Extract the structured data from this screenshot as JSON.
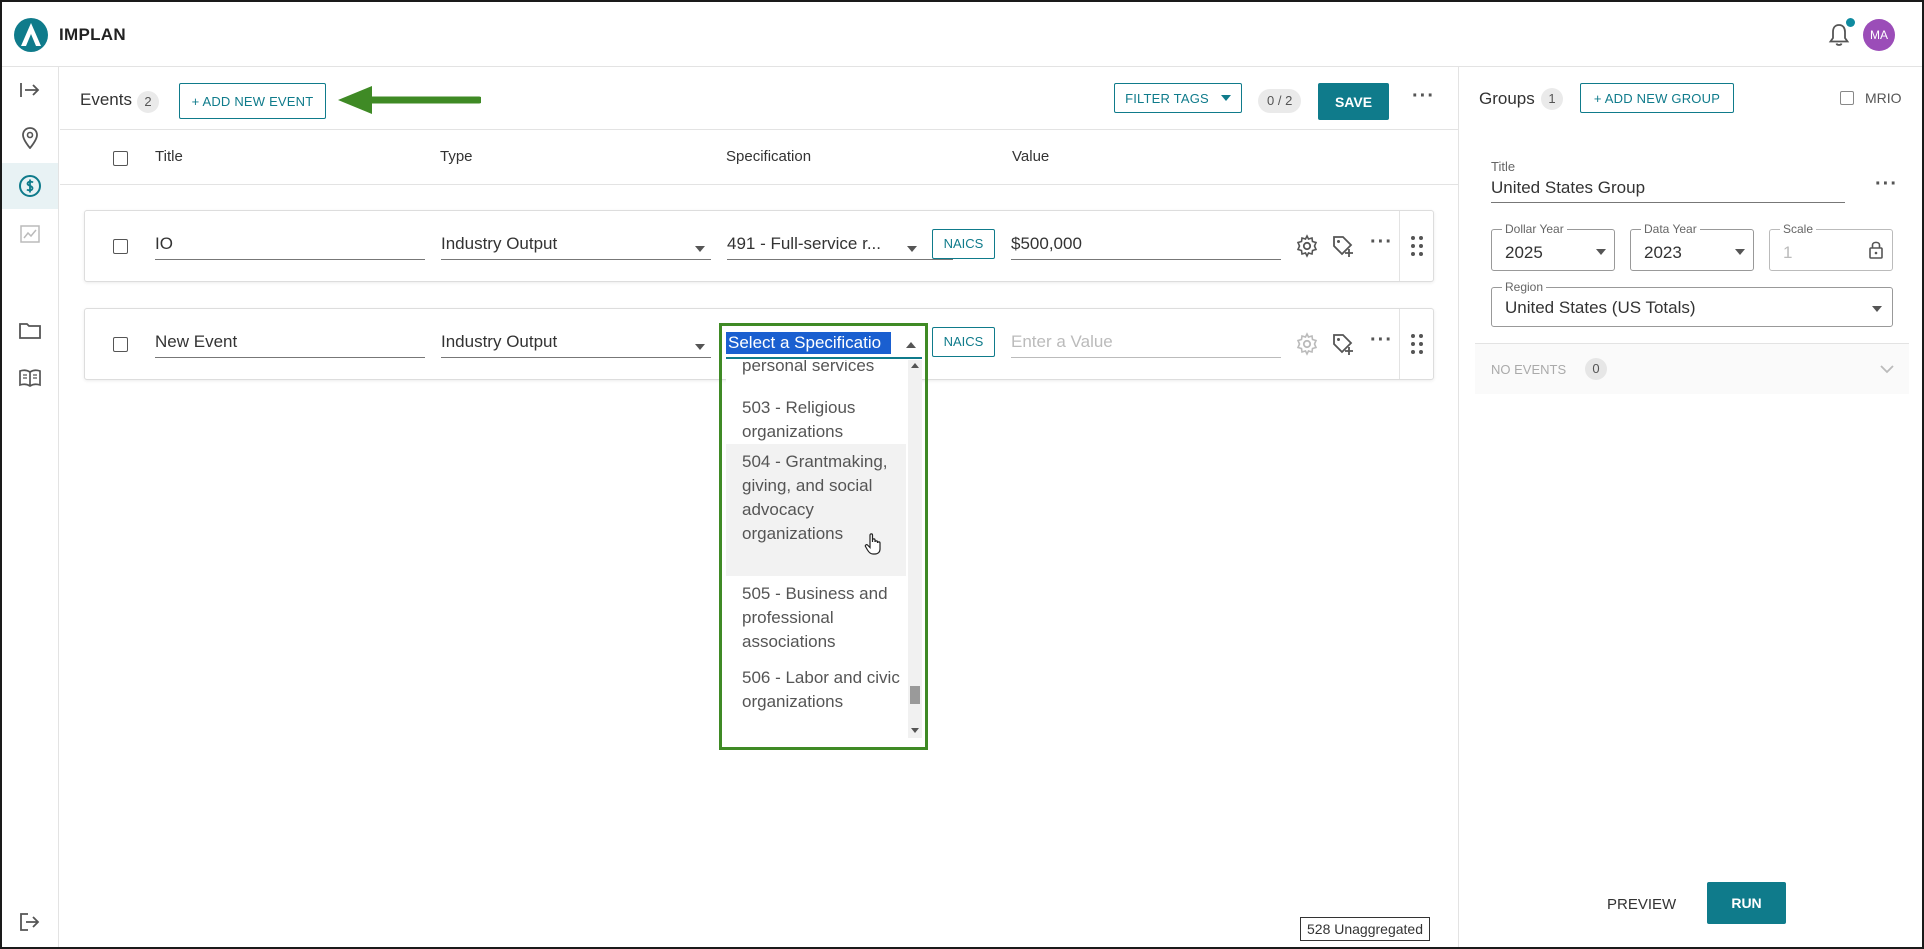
{
  "app": {
    "brand": "IMPLAN",
    "user_initials": "MA"
  },
  "events": {
    "title": "Events",
    "count": "2",
    "add_label": "+ ADD NEW EVENT",
    "filter_tags_label": "FILTER TAGS",
    "pager": "0 / 2",
    "save_label": "SAVE",
    "columns": {
      "title": "Title",
      "type": "Type",
      "specification": "Specification",
      "value": "Value"
    },
    "rows": [
      {
        "title": "IO",
        "type": "Industry Output",
        "specification": "491 - Full-service r...",
        "naics": "NAICS",
        "value": "$500,000"
      },
      {
        "title": "New Event",
        "type": "Industry Output",
        "specification": "Select a Specificatio",
        "naics": "NAICS",
        "value_placeholder": "Enter a Value"
      }
    ]
  },
  "dropdown": {
    "options": [
      "personal services",
      "503 - Religious organizations",
      "504 - Grantmaking, giving, and social advocacy organizations",
      "505 - Business and professional associations",
      "506 - Labor and civic organizations"
    ],
    "hovered_index": 2
  },
  "groups": {
    "title": "Groups",
    "count": "1",
    "add_label": "+ ADD NEW GROUP",
    "mrio_label": "MRIO",
    "card": {
      "title_label": "Title",
      "title_value": "United States Group",
      "dollar_year_label": "Dollar Year",
      "dollar_year_value": "2025",
      "data_year_label": "Data Year",
      "data_year_value": "2023",
      "scale_label": "Scale",
      "scale_value": "1",
      "region_label": "Region",
      "region_value": "United States (US Totals)",
      "no_events_label": "NO EVENTS",
      "no_events_count": "0"
    },
    "preview_label": "PREVIEW",
    "run_label": "RUN"
  },
  "status": {
    "unaggregated": "528 Unaggregated"
  },
  "colors": {
    "accent": "#0f7b8b",
    "highlight_outline": "#3f8a25",
    "selection": "#1a5fd0",
    "avatar": "#9b4db8"
  }
}
